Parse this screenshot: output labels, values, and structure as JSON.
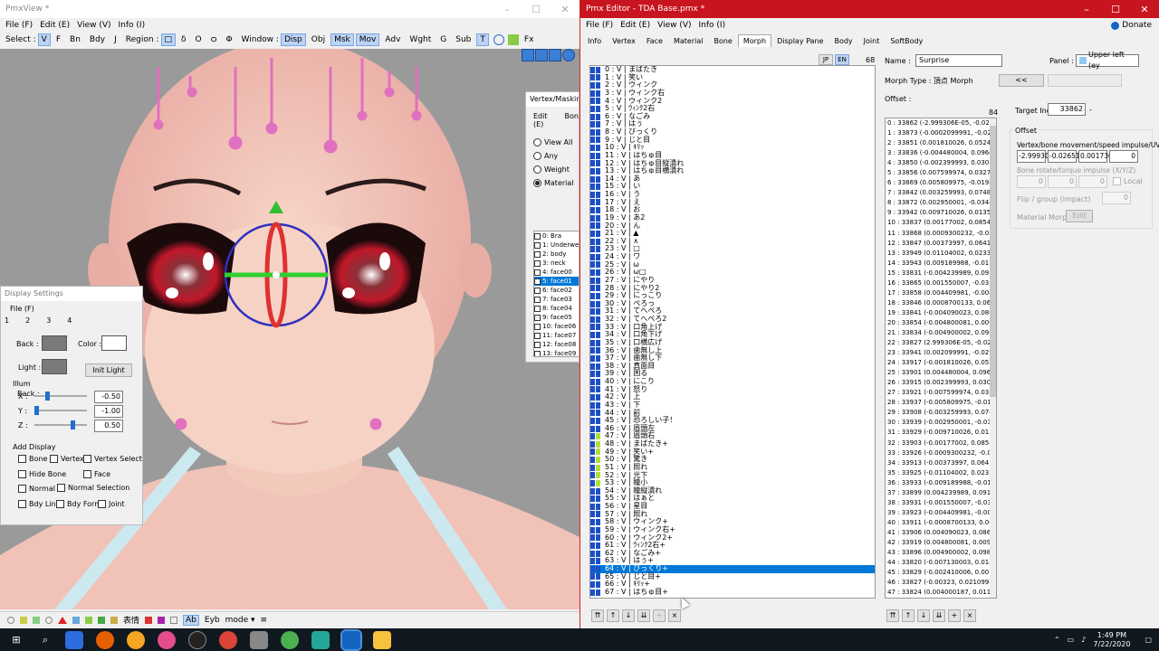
{
  "pmxview": {
    "title": "PmxView *",
    "menu": [
      "File (F)",
      "Edit (E)",
      "View (V)",
      "Info (I)"
    ],
    "toolbar": {
      "select_label": "Select :",
      "select_items": [
        "V",
        "F",
        "Bn",
        "Bdy",
        "J"
      ],
      "region_label": "Region :",
      "region_items": [
        "□",
        "δ",
        "Ο",
        "ѻ",
        "Φ"
      ],
      "window_label": "Window :",
      "window_items": [
        "Disp",
        "Obj",
        "Msk",
        "Mov",
        "Adv",
        "Wght",
        "G",
        "Sub",
        "T"
      ],
      "fx_label": "Fx"
    },
    "bottom_toolbar": [
      "表情",
      "Ab",
      "Eyb",
      "mode ▾",
      "≡"
    ]
  },
  "vertex_masking": {
    "title": "Vertex/Masking",
    "menu": [
      "Edit (E)",
      "Bon"
    ],
    "radios": [
      "View All",
      "Any",
      "Weight",
      "Material"
    ],
    "materials": [
      "0: Bra",
      "1: Underwe",
      "2: body",
      "3: neck",
      "4: face00",
      "5: face01",
      "6: face02",
      "7: face03",
      "8: face04",
      "9: face05",
      "10: face06",
      "11: face07",
      "12: face08",
      "13: face09"
    ],
    "selected_material": "5: face01"
  },
  "display_settings": {
    "title": "Display Settings",
    "menu": "File (F)",
    "tabs": [
      "1",
      "2",
      "3",
      "4"
    ],
    "back_label": "Back :",
    "color_label": "Color :",
    "light_label": "Light :",
    "init_light": "Init Light",
    "illum_label": "Illum",
    "x_label": "X :",
    "x_value": "-0.50",
    "y_label": "Y :",
    "y_value": "-1.00",
    "z_label": "Z :",
    "z_value": "0.50",
    "add_display": "Add Display",
    "checks": [
      "Bone",
      "Vertex",
      "Vertex Select",
      "Hide Bone",
      "Face",
      "Normal",
      "Normal Selection",
      "Bdy Line",
      "Bdy Form",
      "Joint"
    ]
  },
  "pmx_editor": {
    "title": "Pmx Editor - TDA Base.pmx *",
    "menu": [
      "File (F)",
      "Edit (E)",
      "View (V)",
      "Info (I)"
    ],
    "donate": "Donate",
    "tabs": [
      "Info",
      "Vertex",
      "Face",
      "Material",
      "Bone",
      "Morph",
      "Display Pane",
      "Body",
      "Joint",
      "SoftBody"
    ],
    "active_tab": "Morph",
    "lang_jp": "JP",
    "lang_en": "EN",
    "morph_count": "68",
    "morphs": [
      "0 : V | まばたき",
      "1 : V | 笑い",
      "2 : V | ウィンク",
      "3 : V | ウィンク右",
      "4 : V | ウィンク2",
      "5 : V | ｳｨﾝｸ2右",
      "6 : V | なごみ",
      "7 : V | はぅ",
      "8 : V | びっくり",
      "9 : V | じと目",
      "10 : V | ｷﾘｯ",
      "11 : V | はちゅ目",
      "12 : V | はちゅ目縦潰れ",
      "13 : V | はちゅ目横潰れ",
      "14 : V | あ",
      "15 : V | い",
      "16 : V | う",
      "17 : V | え",
      "18 : V | お",
      "19 : V | あ2",
      "20 : V | ん",
      "21 : V | ▲",
      "22 : V | ∧",
      "23 : V | □",
      "24 : V | ワ",
      "25 : V | ω",
      "26 : V | ω□",
      "27 : V | にやり",
      "28 : V | にやり2",
      "29 : V | にっこり",
      "30 : V | ぺろっ",
      "31 : V | てへぺろ",
      "32 : V | てへぺろ2",
      "33 : V | 口角上げ",
      "34 : V | 口角下げ",
      "35 : V | 口横広げ",
      "36 : V | 歯無し上",
      "37 : V | 歯無し下",
      "38 : V | 真面目",
      "39 : V | 困る",
      "40 : V | にこり",
      "41 : V | 怒り",
      "42 : V | 上",
      "43 : V | 下",
      "44 : V | 前",
      "45 : V | 恐ろしい子！",
      "46 : V | 眉頭左",
      "47 : V | 眉頭右",
      "48 : V | まばたき+",
      "49 : V | 笑い+",
      "50 : V | 驚き",
      "51 : V | 照れ",
      "52 : V | 光下",
      "53 : V | 瞳小",
      "54 : V | 瞳縦潰れ",
      "55 : V | はぁと",
      "56 : V | 星目",
      "57 : V | 照れ",
      "58 : V | ウィンク+",
      "59 : V | ウィンク右+",
      "60 : V | ウィンク2+",
      "61 : V | ｳｨﾝｸ2右+",
      "62 : V | なごみ+",
      "63 : V | はぅ+",
      "64 : V | びっくり+",
      "65 : V | じと目+",
      "66 : V | ｷﾘｯ+",
      "67 : V | はちゅ目+"
    ],
    "selected_morph_index": 64,
    "name_label": "Name :",
    "name_value": "Surprise",
    "panel_label": "Panel :",
    "panel_value": "Upper left (ey",
    "morph_type_label": "Morph Type : 頂点 Morph",
    "offset_label": "Offset :",
    "offset_count": "84",
    "target_index_label": "Target Index :",
    "target_index_value": "33862",
    "offsets": [
      "0 : 33862 (-2.999306E-05, -0.026F",
      "1 : 33873 (-0.0002099991, -0.0294",
      "2 : 33851 (0.001810026, 0.05247(",
      "3 : 33836 (-0.004480004, 0.09643",
      "4 : 33850 (-0.002399993, 0.03078",
      "5 : 33856 (0.007599974, 0.03275",
      "6 : 33869 (0.005809975, -0.01984",
      "7 : 33842 (0.003259993, 0.07489",
      "8 : 33872 (0.002950001, -0.03449",
      "9 : 33942 (0.009710026, 0.01350",
      "10 : 33837 (0.00177002, 0.08549",
      "11 : 33868 (0.0009300232, -0.037",
      "12 : 33847 (0.00373997, 0.06416",
      "13 : 33949 (0.01104002, 0.02337",
      "14 : 33943 (0.009189988, -0.0174",
      "15 : 33831 (-0.004239989, 0.0917",
      "16 : 33865 (0.001550007, -0.0350",
      "17 : 33858 (0.004409981, -0.0087",
      "18 : 33846 (0.0008700133, 0.0632",
      "19 : 33841 (-0.004090023, 0.0861",
      "20 : 33854 (-0.004800081, 0.009",
      "21 : 33834 (-0.004900002, 0.0985",
      "22 : 33827 (2.999306E-05, -0.026",
      "23 : 33941 (0.002099991, -0.029",
      "24 : 33917 (-0.001810026, 0.0524",
      "25 : 33901 (0.004480004, 0.0964",
      "26 : 33915 (0.002399993, 0.0307",
      "27 : 33921 (-0.007599974, 0.0332",
      "28 : 33937 (-0.005809975, -0.019",
      "29 : 33908 (-0.003259993, 0.0748",
      "30 : 33939 (-0.002950001, -0.034",
      "31 : 33929 (-0.009710026, 0.0135",
      "32 : 33903 (-0.00177002, 0.08549",
      "33 : 33926 (-0.0009300232, -0.037",
      "34 : 33913 (-0.00373997, 0.0641",
      "35 : 33925 (-0.01104002, 0.02337",
      "36 : 33933 (-0.009189988, -0.017",
      "37 : 33899 (0.004239989, 0.0917",
      "38 : 33931 (-0.001550007, -0.035",
      "39 : 33923 (-0.004409981, -0.0087",
      "40 : 33911 (-0.0008700133, 0.063",
      "41 : 33906 (0.004090023, 0.0861",
      "42 : 33919 (0.004800081, 0.009",
      "43 : 33896 (0.004900002, 0.0985",
      "44 : 33820 (-0.007130003, 0.0145",
      "45 : 33829 (-0.002410006, 0.0019",
      "46 : 33827 (-0.00323, 0.02109985",
      "47 : 33824 (0.004000187, 0.011"
    ],
    "offset_group": "Offset",
    "vertex_move_label": "Vertex/bone movement/speed impulse/UV",
    "vertex_move_values": [
      "-2.99930",
      "-0.02651",
      "0.001730",
      "0"
    ],
    "bone_rotate_label": "Bone rotate/torque impulse (X/Y/Z)",
    "bone_rotate_values": [
      "0",
      "0",
      "0"
    ],
    "local_label": "Local",
    "flip_label": "Flip / group (impact)",
    "flip_value": "0",
    "material_morph_label": "Material Morph",
    "edit_label": "Edit"
  },
  "taskbar": {
    "time": "1:49 PM",
    "date": "7/22/2020"
  }
}
